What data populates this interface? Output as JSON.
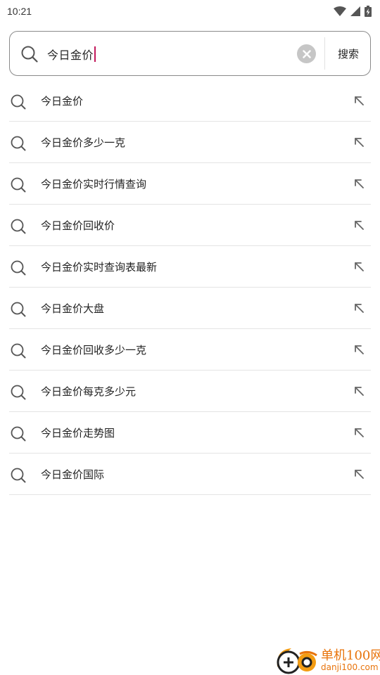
{
  "status_bar": {
    "time": "10:21",
    "icons": [
      "wifi-icon",
      "signal-icon",
      "battery-charging-icon"
    ]
  },
  "search": {
    "value": "今日金价",
    "search_button_label": "搜索",
    "caret_color": "#c2185b"
  },
  "suggestions": [
    {
      "text": "今日金价"
    },
    {
      "text": "今日金价多少一克"
    },
    {
      "text": "今日金价实时行情查询"
    },
    {
      "text": "今日金价回收价"
    },
    {
      "text": "今日金价实时查询表最新"
    },
    {
      "text": "今日金价大盘"
    },
    {
      "text": "今日金价回收多少一克"
    },
    {
      "text": "今日金价每克多少元"
    },
    {
      "text": "今日金价走势图"
    },
    {
      "text": "今日金价国际"
    }
  ],
  "watermark": {
    "title": "单机100网",
    "url": "danji100.com",
    "color": "#e8740c"
  }
}
